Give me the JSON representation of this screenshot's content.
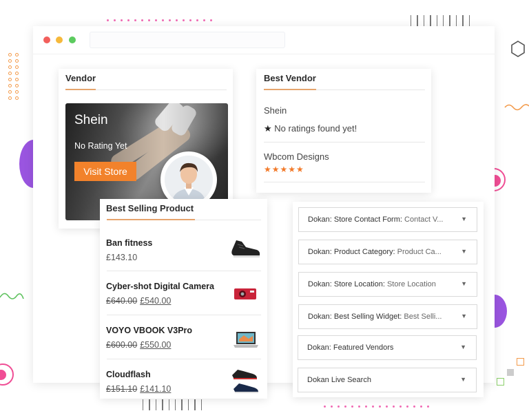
{
  "vendor_widget": {
    "title": "Vendor",
    "store_name": "Shein",
    "rating_text": "No Rating Yet",
    "visit_label": "Visit Store"
  },
  "best_vendor": {
    "title": "Best Vendor",
    "vendors": [
      {
        "name": "Shein",
        "rating_text": "No ratings found yet!"
      },
      {
        "name": "Wbcom Designs",
        "stars": "★★★★★",
        "rating": 5
      }
    ]
  },
  "best_selling": {
    "title": "Best Selling Product",
    "products": [
      {
        "name": "Ban fitness",
        "price": "£143.10"
      },
      {
        "name": "Cyber-shot Digital Camera",
        "old_price": "£640.00",
        "price": "£540.00"
      },
      {
        "name": "VOYO VBOOK V3Pro",
        "old_price": "£600.00",
        "price": "£550.00"
      },
      {
        "name": "Cloudflash",
        "old_price": "£151.10",
        "price": "£141.10"
      }
    ]
  },
  "widgets": [
    {
      "name": "Dokan: Store Contact Form:",
      "sub": "Contact V..."
    },
    {
      "name": "Dokan: Product Category:",
      "sub": "Product Ca..."
    },
    {
      "name": "Dokan: Store Location:",
      "sub": "Store Location"
    },
    {
      "name": "Dokan: Best Selling Widget:",
      "sub": "Best Selli..."
    },
    {
      "name": "Dokan: Featured Vendors",
      "sub": ""
    },
    {
      "name": "Dokan Live Search",
      "sub": ""
    }
  ],
  "icons": {
    "star": "star-icon",
    "dropdown": "triangle-down-icon",
    "hexagon": "hexagon-icon"
  },
  "colors": {
    "accent_orange": "#f2822b",
    "window_red": "#f25f5c",
    "window_yellow": "#f6b93b",
    "window_green": "#5ccb5f",
    "purple": "#8e4fd8",
    "pink": "#f0428c"
  }
}
